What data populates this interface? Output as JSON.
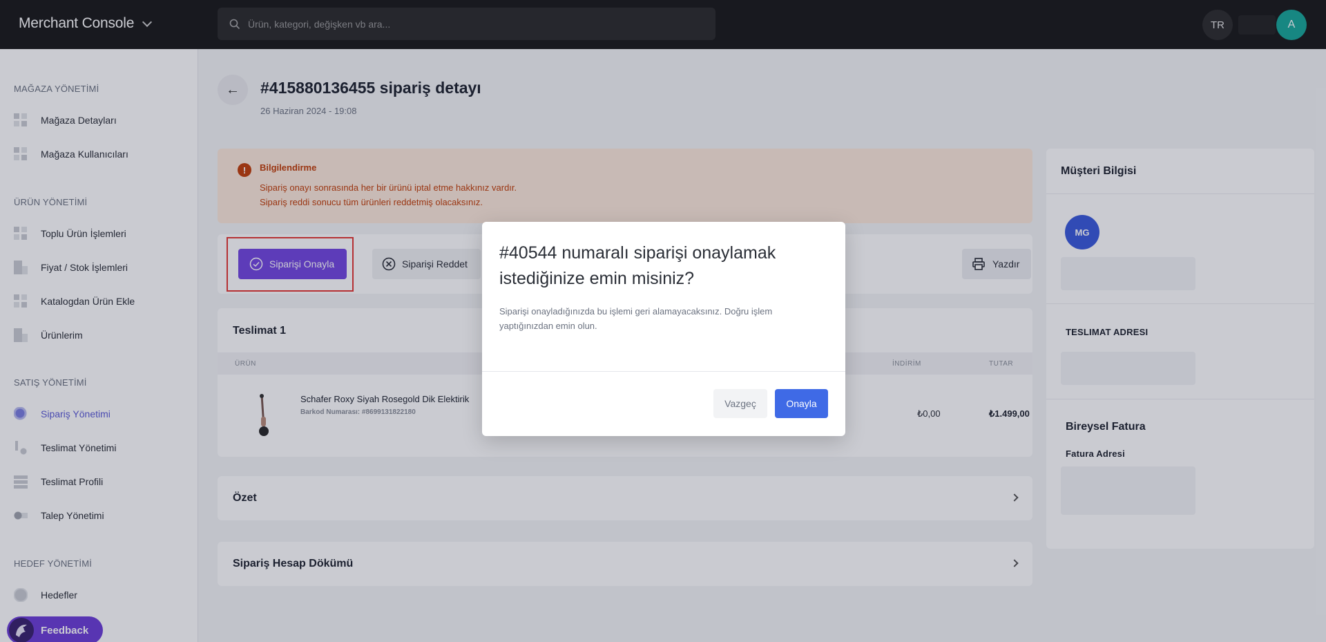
{
  "app": {
    "title": "Merchant Console"
  },
  "search": {
    "placeholder": "Ürün, kategori, değişken vb ara..."
  },
  "header": {
    "lang": "TR",
    "avatar": "A"
  },
  "sidebar": {
    "sections": [
      {
        "title": "MAĞAZA YÖNETİMİ"
      },
      {
        "title": "ÜRÜN YÖNETİMİ"
      },
      {
        "title": "SATIŞ YÖNETİMİ"
      },
      {
        "title": "HEDEF YÖNETİMİ"
      }
    ],
    "items": [
      {
        "label": "Mağaza Detayları",
        "icon": "grid-icon"
      },
      {
        "label": "Mağaza Kullanıcıları",
        "icon": "grid-icon"
      },
      {
        "label": "Toplu Ürün İşlemleri",
        "icon": "grid-icon"
      },
      {
        "label": "Fiyat / Stok İşlemleri",
        "icon": "document-icon"
      },
      {
        "label": "Katalogdan Ürün Ekle",
        "icon": "grid-icon"
      },
      {
        "label": "Ürünlerim",
        "icon": "document-icon"
      },
      {
        "label": "Sipariş Yönetimi",
        "icon": "cube-icon",
        "active": true
      },
      {
        "label": "Teslimat Yönetimi",
        "icon": "truck-icon"
      },
      {
        "label": "Teslimat Profili",
        "icon": "stack-icon"
      },
      {
        "label": "Talep Yönetimi",
        "icon": "toggle-icon"
      },
      {
        "label": "Hedefler",
        "icon": "target-icon"
      }
    ],
    "feedback": "Feedback"
  },
  "order": {
    "title": "#415880136455 sipariş detayı",
    "date": "26 Haziran 2024 - 19:08"
  },
  "alert": {
    "title": "Bilgilendirme",
    "line1": "Sipariş onayı sonrasında her bir ürünü iptal etme hakkınız vardır.",
    "line2": "Sipariş reddi sonucu tüm ürünleri reddetmiş olacaksınız."
  },
  "actions": {
    "approve": "Siparişi Onayla",
    "reject": "Siparişi Reddet",
    "print": "Yazdır"
  },
  "delivery": {
    "title": "Teslimat 1",
    "columns": {
      "product": "ÜRÜN",
      "discount": "İNDİRİM",
      "total": "TUTAR"
    },
    "rows": [
      {
        "name": "Schafer Roxy Siyah Rosegold Dik Elektirik",
        "barcode": "Barkod Numarası: #8699131822180",
        "discount": "₺0,00",
        "total": "₺1.499,00"
      }
    ]
  },
  "summary": {
    "title": "Özet"
  },
  "breakdown": {
    "title": "Sipariş Hesap Dökümü"
  },
  "customer": {
    "title": "Müşteri Bilgisi",
    "initials": "MG",
    "shipping_title": "TESLIMAT ADRESI",
    "invoice_title": "Bireysel Fatura",
    "invoice_address": "Fatura Adresi"
  },
  "modal": {
    "title": "#40544 numaralı siparişi onaylamak istediğinize emin misiniz?",
    "body": "Siparişi onayladığınızda bu işlemi geri alamayacaksınız. Doğru işlem yaptığınızdan emin olun.",
    "cancel": "Vazgeç",
    "confirm": "Onayla"
  },
  "colors": {
    "accent": "#7448e0",
    "confirm": "#3f6ae6",
    "warning": "#c2410c",
    "avatar": "#1aa89a"
  }
}
